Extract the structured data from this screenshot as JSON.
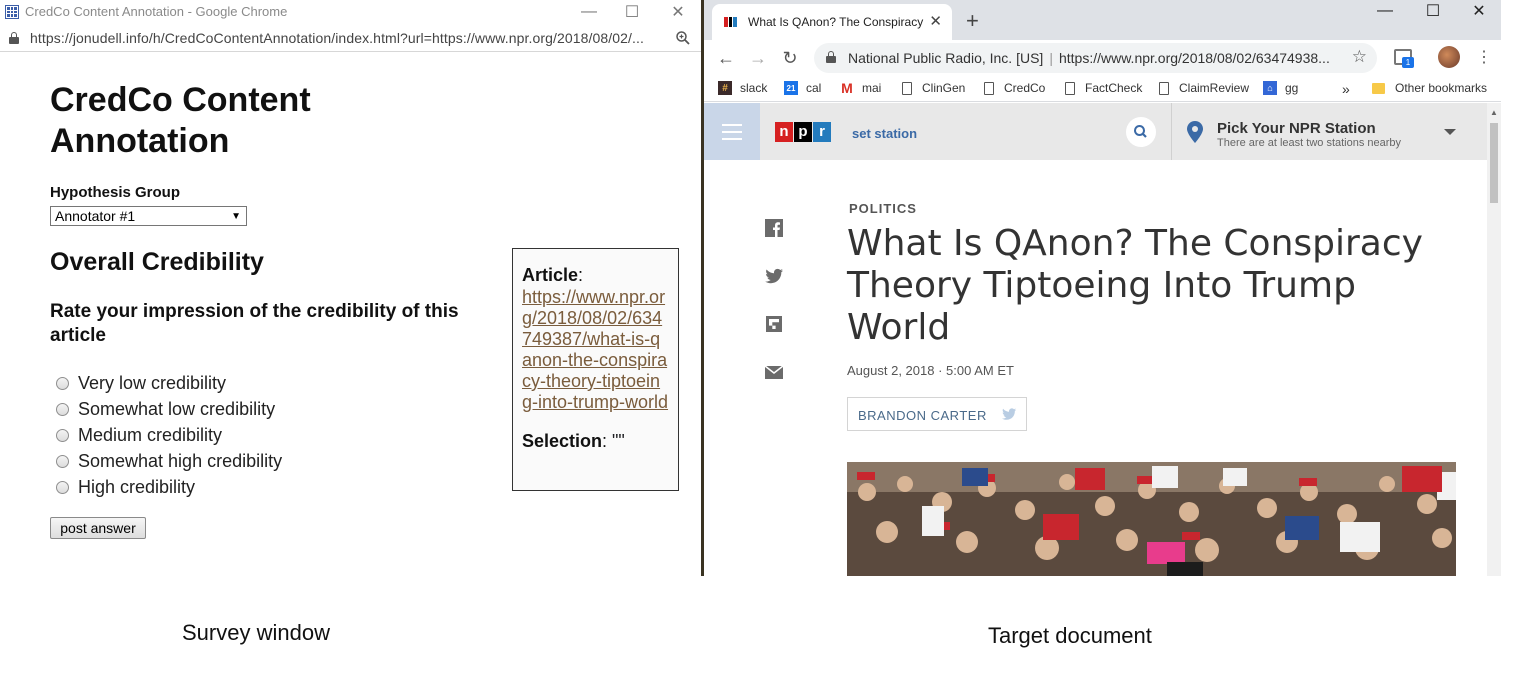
{
  "survey_window": {
    "title_bar": "CredCo Content Annotation - Google Chrome",
    "address": "https://jonudell.info/h/CredCoContentAnnotation/index.html?url=https://www.npr.org/2018/08/02/...",
    "page_title": "CredCo Content Annotation",
    "group_label": "Hypothesis Group",
    "group_selected": "Annotator #1",
    "section_title": "Overall Credibility",
    "question": "Rate your impression of the credibility of this article",
    "options": [
      "Very low credibility",
      "Somewhat low credibility",
      "Medium credibility",
      "Somewhat high credibility",
      "High credibility"
    ],
    "post_button": "post answer",
    "article_label": "Article",
    "article_url": "https://www.npr.org/2018/08/02/634749387/what-is-qanon-the-conspiracy-theory-tiptoeing-into-trump-world",
    "selection_label": "Selection",
    "selection_value": "\"\""
  },
  "target_window": {
    "tab_title": "What Is QAnon? The Conspiracy",
    "omnibox_org": "National Public Radio, Inc. [US]",
    "omnibox_url": "https://www.npr.org/2018/08/02/63474938...",
    "ext_badge": "1",
    "bookmarks": [
      "slack",
      "cal",
      "mai",
      "ClinGen",
      "CredCo",
      "FactCheck",
      "ClaimReview",
      "gg"
    ],
    "bookmarks_more": "»",
    "other_bookmarks": "Other bookmarks",
    "cal_badge": "21",
    "npr_letters": [
      "n",
      "p",
      "r"
    ],
    "set_station": "set station",
    "pick_station_title": "Pick Your NPR Station",
    "pick_station_sub": "There are at least two stations nearby",
    "kicker": "POLITICS",
    "headline": "What Is QAnon? The Conspiracy Theory Tiptoeing Into Trump World",
    "dateline": "August 2, 2018 · 5:00 AM ET",
    "byline": "BRANDON CARTER"
  },
  "captions": {
    "left": "Survey window",
    "right": "Target document"
  },
  "colors": {
    "npr_red": "#d62021",
    "npr_black": "#000000",
    "npr_blue": "#237bbd",
    "link_brown": "#7a5c3c",
    "station_blue": "#3b6aa6"
  }
}
